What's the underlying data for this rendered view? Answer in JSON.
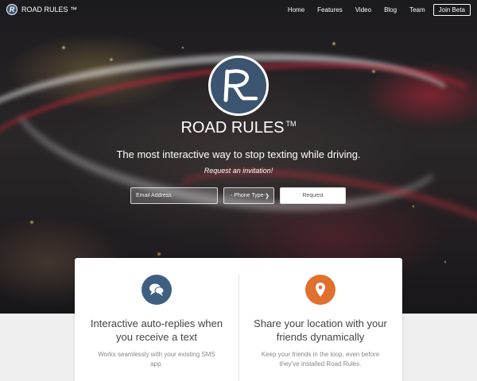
{
  "brand": {
    "name": "ROAD RULES ™",
    "logo_letter": "R"
  },
  "nav": {
    "items": [
      {
        "label": "Home"
      },
      {
        "label": "Features"
      },
      {
        "label": "Video"
      },
      {
        "label": "Blog"
      },
      {
        "label": "Team"
      }
    ],
    "beta_label": "Join Beta"
  },
  "hero": {
    "title": "ROAD RULES",
    "trademark": "TM",
    "tagline": "The most interactive way to stop texting while driving.",
    "invite_text": "Request an invitation!",
    "email_placeholder": "Email Address",
    "phone_select_value": "- Phone Type-",
    "request_label": "Request"
  },
  "features": [
    {
      "icon": "chat-bubbles-icon",
      "title": "Interactive auto-replies when you receive a text",
      "description": "Works seamlessly with your existing SMS app."
    },
    {
      "icon": "location-pin-icon",
      "title": "Share your location with your friends dynamically",
      "description": "Keep your friends in the loop, even before they've installed Road Rules."
    }
  ],
  "colors": {
    "logo_blue": "#3b5470",
    "feature_blue": "#3f5f80",
    "feature_orange": "#e0702e",
    "page_bg": "#efefef"
  }
}
